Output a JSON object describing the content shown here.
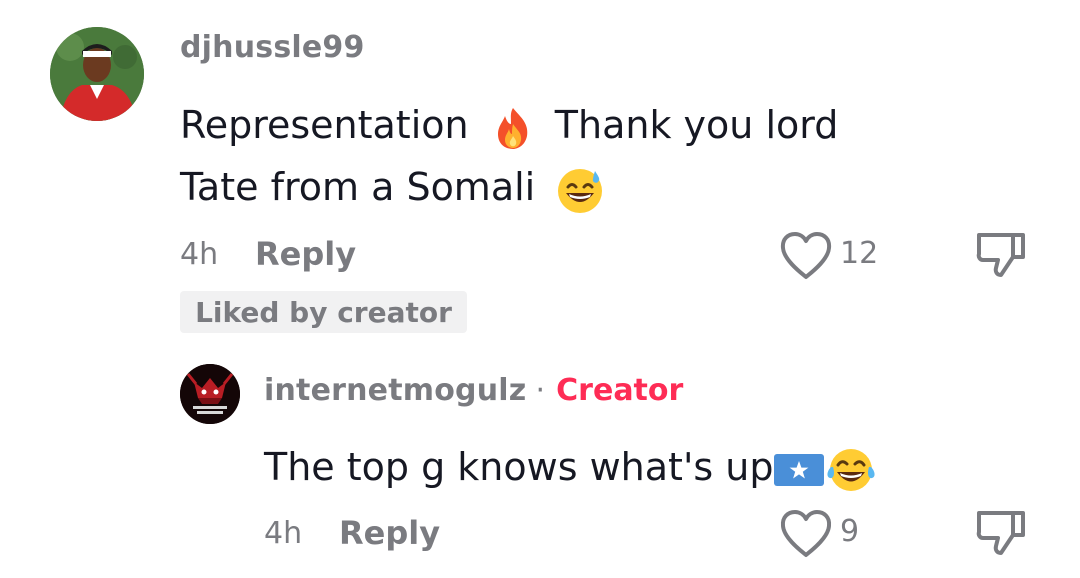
{
  "comment": {
    "username": "djhussle99",
    "text_line1": "Representation",
    "text_line1b": "Thank you lord",
    "text_line2": "Tate from a Somali",
    "time": "4h",
    "reply_label": "Reply",
    "like_count": "12",
    "liked_by_creator": "Liked by creator",
    "icons": [
      "fire-emoji",
      "sweat-smile-emoji",
      "heart-outline-icon",
      "thumbs-down-icon"
    ]
  },
  "reply": {
    "username": "internetmogulz",
    "separator": "·",
    "creator_label": "Creator",
    "text": "The top g knows what's up",
    "avatar_text": "INTERNET MOGULZ",
    "time": "4h",
    "reply_label": "Reply",
    "like_count": "9",
    "icons": [
      "somalia-flag-emoji",
      "tears-of-joy-emoji",
      "heart-outline-icon",
      "thumbs-down-icon"
    ]
  },
  "colors": {
    "text": "#161823",
    "muted": "#7a7b80",
    "creator": "#fe2c55",
    "pill_bg": "#f1f1f2"
  }
}
